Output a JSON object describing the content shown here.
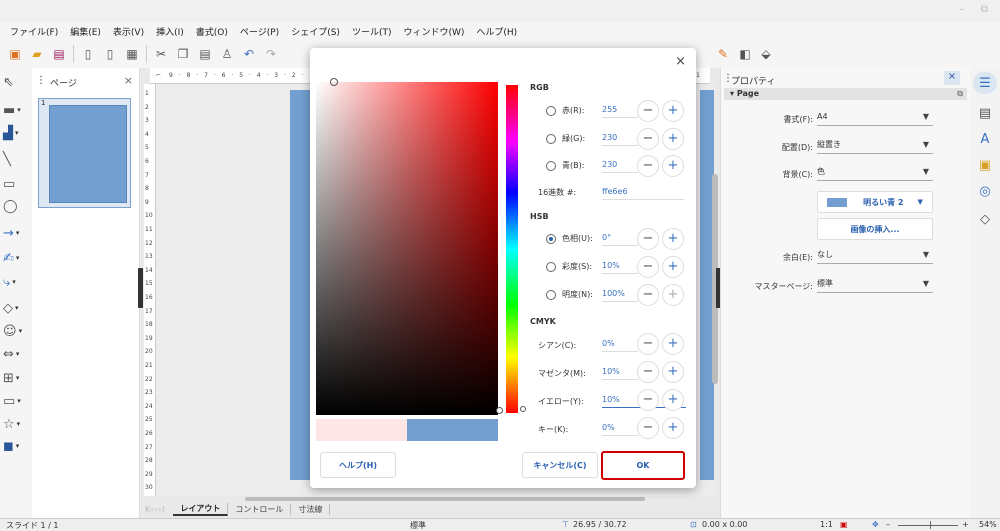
{
  "menu": [
    "ファイル(F)",
    "編集(E)",
    "表示(V)",
    "挿入(I)",
    "書式(O)",
    "ページ(P)",
    "シェイプ(S)",
    "ツール(T)",
    "ウィンドウ(W)",
    "ヘルプ(H)"
  ],
  "toolbar_icons": [
    "new-icon",
    "open-icon",
    "save-icon",
    "export-icon",
    "export-pdf-icon",
    "print-icon",
    "cut-icon",
    "copy-icon",
    "paste-icon",
    "clone-icon",
    "undo-icon",
    "redo-icon"
  ],
  "pages_panel": {
    "title": "ページ",
    "page_number": "1"
  },
  "ruler": {
    "h_ticks": [
      "9",
      "8",
      "7",
      "6",
      "5",
      "4",
      "3",
      "2",
      "1",
      "1",
      "2",
      "3",
      "4",
      "5",
      "6",
      "7",
      "8",
      "9",
      "10",
      "11",
      "12"
    ],
    "right_ticks": "30 · 31",
    "v_ticks": [
      "1",
      "2",
      "3",
      "4",
      "5",
      "6",
      "7",
      "8",
      "9",
      "10",
      "11",
      "12",
      "13",
      "14",
      "15",
      "16",
      "17",
      "18",
      "19",
      "20",
      "21",
      "22",
      "23",
      "24",
      "25",
      "26",
      "27",
      "28",
      "29",
      "30"
    ]
  },
  "tabs": {
    "nav": "K ‹ › › I",
    "items": [
      "レイアウト",
      "コントロール",
      "寸法線"
    ]
  },
  "statusbar": {
    "slide": "スライド 1 / 1",
    "style": "標準",
    "position": "26.95 / 30.72",
    "size": "0.00 x 0.00",
    "ratio": "1:1",
    "zoom_minus": "–",
    "zoom_plus": "+",
    "zoom": "54%"
  },
  "properties": {
    "title": "プロパティ",
    "close": "×",
    "section": "Page",
    "format_label": "書式(F):",
    "format_value": "A4",
    "orientation_label": "配置(D):",
    "orientation_value": "縦置き",
    "background_label": "背景(C):",
    "background_value": "色",
    "color_button": "明るい青 2",
    "insert_image_button": "画像の挿入...",
    "margin_label": "余白(E):",
    "margin_value": "なし",
    "master_label": "マスターページ:",
    "master_value": "標準"
  },
  "deck_icons": [
    "properties-icon",
    "slide-transition-icon",
    "styles-icon",
    "gallery-icon",
    "navigator-icon",
    "shapes-icon"
  ],
  "dialog": {
    "close": "×",
    "rgb_title": "RGB",
    "red_label": "赤(R):",
    "red_value": "255",
    "green_label": "緑(G):",
    "green_value": "230",
    "blue_label": "青(B):",
    "blue_value": "230",
    "hex_label": "16進数 #:",
    "hex_value": "ffe6e6",
    "hsb_title": "HSB",
    "hue_label": "色相(U):",
    "hue_value": "0°",
    "sat_label": "彩度(S):",
    "sat_value": "10%",
    "bright_label": "明度(N):",
    "bright_value": "100%",
    "cmyk_title": "CMYK",
    "cyan_label": "シアン(C):",
    "cyan_value": "0%",
    "magenta_label": "マゼンタ(M):",
    "magenta_value": "10%",
    "yellow_label": "イエロー(Y):",
    "yellow_value": "10%",
    "key_label": "キー(K):",
    "key_value": "0%",
    "minus": "−",
    "plus": "+",
    "help_button": "ヘルプ(H)",
    "cancel_button": "キャンセル(C)",
    "ok_button": "OK",
    "new_color": "#ffe6e6",
    "old_color": "#729fcf"
  }
}
